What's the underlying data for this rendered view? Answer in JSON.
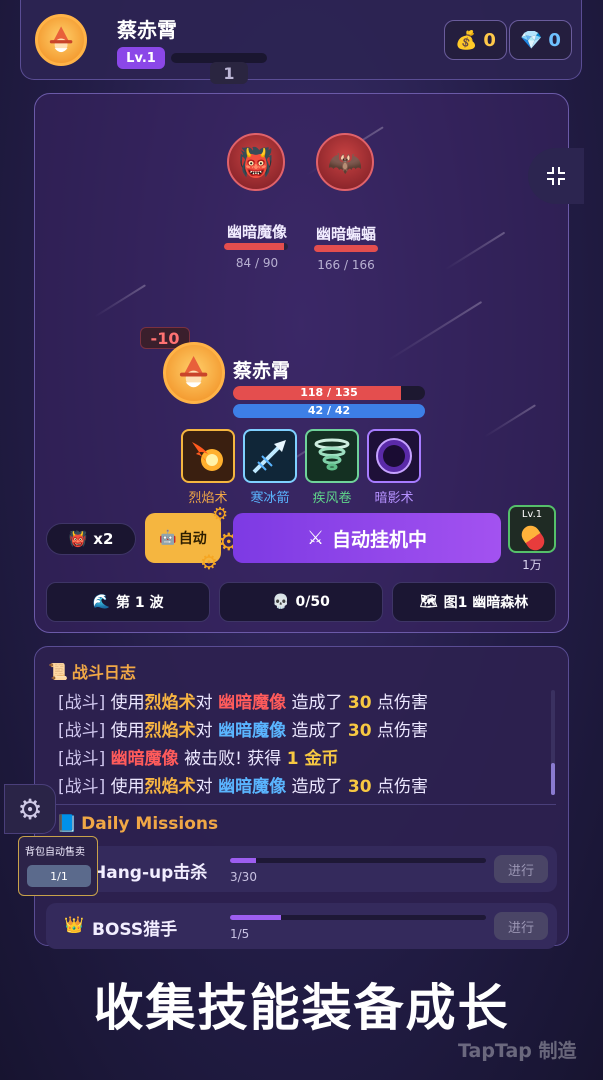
{
  "header": {
    "player_name": "蔡赤霄",
    "level_label": "Lv.1",
    "level_number": "1",
    "xp_progress": 0.0,
    "gold": "0",
    "gems": "0",
    "gold_icon": "money-bag-icon",
    "gem_icon": "diamond-icon"
  },
  "enemies": [
    {
      "name": "幽暗魔像",
      "hp": "84 / 90",
      "hp_fraction": 0.93,
      "icon": "demon-mask-icon"
    },
    {
      "name": "幽暗蝙蝠",
      "hp": "166 / 166",
      "hp_fraction": 1.0,
      "icon": "bat-icon"
    }
  ],
  "hero": {
    "name": "蔡赤霄",
    "damage_taken": "-10",
    "hp_text": "118 / 135",
    "hp_fraction": 0.874,
    "mp_text": "42 / 42",
    "mp_fraction": 1.0
  },
  "skills": [
    {
      "label": "烈焰术",
      "color": "#f0a746",
      "icon": "fireball-icon"
    },
    {
      "label": "寒冰箭",
      "color": "#5ab5ff",
      "icon": "ice-arrow-icon"
    },
    {
      "label": "疾风卷",
      "color": "#5fd38a",
      "icon": "tornado-icon"
    },
    {
      "label": "暗影术",
      "color": "#b591ff",
      "icon": "shadow-orb-icon"
    }
  ],
  "controls": {
    "multiplier": "x2",
    "auto_label": "自动",
    "hangup_label": "自动挂机中",
    "potion_level": "Lv.1",
    "potion_count": "1万"
  },
  "info": {
    "wave": "第 1 波",
    "kills": "0/50",
    "map": "图1 幽暗森林"
  },
  "log": {
    "title": "战斗日志",
    "lines": [
      {
        "tag": "[战斗]",
        "p1": " 使用",
        "skill": "烈焰术",
        "p2": "对 ",
        "enemy": "幽暗魔像",
        "enemy_color": "red",
        "p3": " 造成了 ",
        "num": "30",
        "p4": " 点伤害"
      },
      {
        "tag": "[战斗]",
        "p1": " 使用",
        "skill": "烈焰术",
        "p2": "对 ",
        "enemy": "幽暗魔像",
        "enemy_color": "blue",
        "p3": " 造成了 ",
        "num": "30",
        "p4": " 点伤害"
      },
      {
        "tag": "[战斗]",
        "p1": " ",
        "skill": "",
        "p2": "",
        "enemy": "幽暗魔像",
        "enemy_color": "red",
        "p3": " 被击败! 获得 ",
        "num": "1 金币",
        "p4": ""
      },
      {
        "tag": "[战斗]",
        "p1": " 使用",
        "skill": "烈焰术",
        "p2": "对 ",
        "enemy": "幽暗魔像",
        "enemy_color": "blue",
        "p3": " 造成了 ",
        "num": "30",
        "p4": " 点伤害"
      }
    ]
  },
  "missions": {
    "title": "Daily Missions",
    "items": [
      {
        "name": "Hang-up击杀",
        "progress": "3/30",
        "fraction": 0.1,
        "button": "进行"
      },
      {
        "name": "BOSS猎手",
        "progress": "1/5",
        "fraction": 0.2,
        "button": "进行",
        "icon": "crown-icon"
      }
    ]
  },
  "side": {
    "autosell_label": "背包自动售卖",
    "autosell_count": "1/1"
  },
  "slogan": "收集技能装备成长",
  "watermark": "TapTap 制造"
}
